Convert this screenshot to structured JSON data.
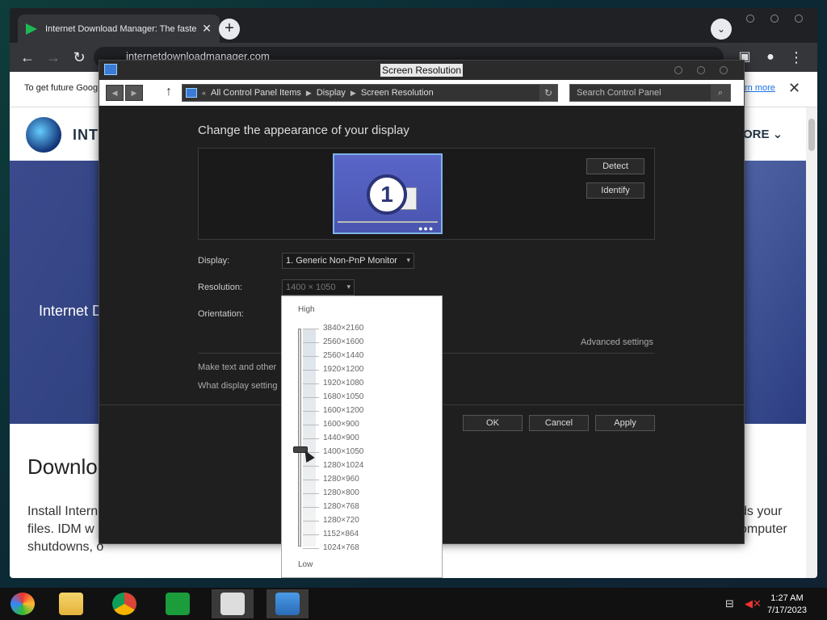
{
  "browser": {
    "tab_title": "Internet Download Manager: The faste",
    "url": "internetdownloadmanager.com",
    "infobar_text": "To get future Goog",
    "infobar_link": "rn more",
    "site_name": "INTE",
    "site_more": "ORE",
    "hero_text": "Internet D",
    "download_title": "Downlo",
    "para_lines": [
      "Install Intern",
      "files. IDM w",
      "shutdowns, o"
    ],
    "para_right_lines": [
      "ds your",
      "omputer"
    ]
  },
  "window": {
    "title": "Screen Resolution",
    "breadcrumb": [
      "All Control Panel Items",
      "Display",
      "Screen Resolution"
    ],
    "search_placeholder": "Search Control Panel"
  },
  "content": {
    "heading": "Change the appearance of your display",
    "monitor_number": "1",
    "detect_label": "Detect",
    "identify_label": "Identify",
    "display_label": "Display:",
    "display_value": "1. Generic Non-PnP Monitor",
    "resolution_label": "Resolution:",
    "resolution_value": "1400 × 1050",
    "orientation_label": "Orientation:",
    "advanced_link": "Advanced settings",
    "make_text_link": "Make text and other",
    "what_display_link": "What display setting",
    "ok_label": "OK",
    "cancel_label": "Cancel",
    "apply_label": "Apply"
  },
  "dropdown": {
    "high_label": "High",
    "low_label": "Low",
    "selected": "1400×1050",
    "resolutions": [
      "3840×2160",
      "2560×1600",
      "2560×1440",
      "1920×1200",
      "1920×1080",
      "1680×1050",
      "1600×1200",
      "1600×900",
      "1440×900",
      "1400×1050",
      "1280×1024",
      "1280×960",
      "1280×800",
      "1280×768",
      "1280×720",
      "1152×864",
      "1024×768"
    ]
  },
  "taskbar": {
    "time": "1:27 AM",
    "date": "7/17/2023",
    "apps": [
      "media-app-icon",
      "file-explorer-icon",
      "chrome-icon",
      "store-icon",
      "archive-icon",
      "control-panel-icon"
    ]
  }
}
